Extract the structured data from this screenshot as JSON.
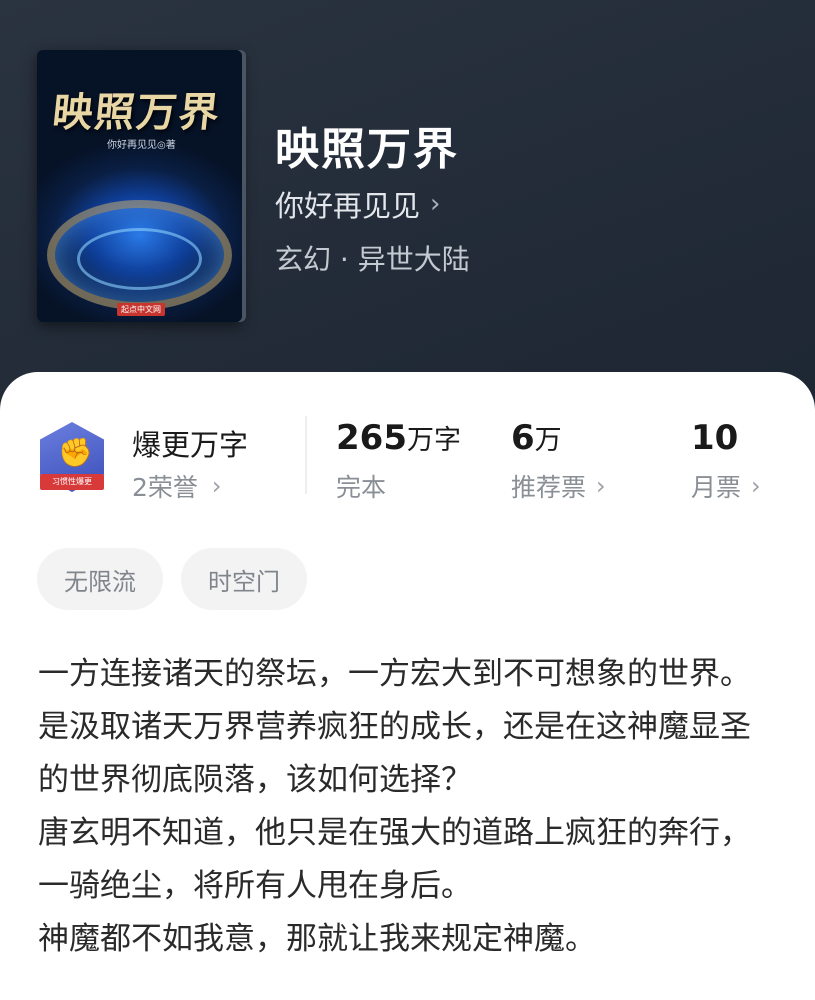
{
  "book": {
    "cover_title": "映照万界",
    "cover_author": "你好再见见◎著",
    "cover_publisher": "起点中文网",
    "title": "映照万界",
    "author": "你好再见见",
    "genre": "玄幻 · 异世大陆"
  },
  "honor": {
    "badge_ribbon": "习惯性爆更",
    "title": "爆更万字",
    "subtitle": "2荣誉"
  },
  "stats": [
    {
      "value": "265",
      "unit": "万字",
      "label": "完本"
    },
    {
      "value": "6",
      "unit": "万",
      "label": "推荐票"
    },
    {
      "value": "10",
      "unit": "",
      "label": "月票"
    }
  ],
  "tags": [
    "无限流",
    "时空门"
  ],
  "description": [
    "一方连接诸天的祭坛，一方宏大到不可想象的世界。",
    "是汲取诸天万界营养疯狂的成长，还是在这神魔显圣的世界彻底陨落，该如何选择？",
    "唐玄明不知道，他只是在强大的道路上疯狂的奔行，一骑绝尘，将所有人甩在身后。",
    "神魔都不如我意，那就让我来规定神魔。"
  ],
  "icons": {
    "chevron": "chevron-right-icon",
    "badge": "fist-badge-icon"
  },
  "colors": {
    "header_bg": "#1f2834",
    "card_bg": "#ffffff",
    "tag_bg": "#f3f3f4",
    "muted_text": "#8a8f96"
  }
}
